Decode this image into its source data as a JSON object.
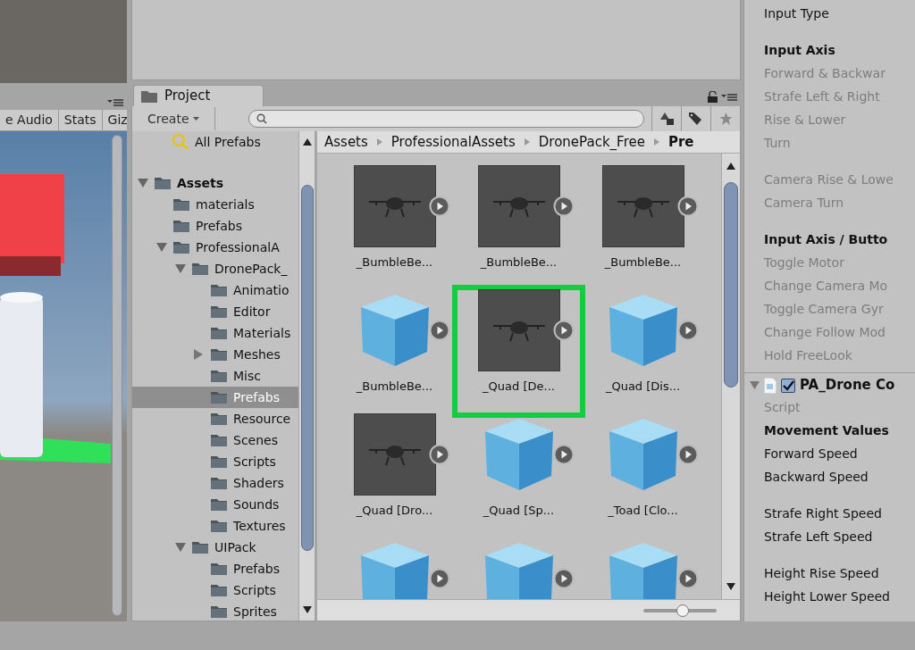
{
  "scene_view": {
    "toolbar": [
      "e Audio",
      "Stats",
      "Giz"
    ]
  },
  "project": {
    "tab": "Project",
    "create_button": "Create",
    "favorites": [
      {
        "label": "All Prefabs",
        "selected": false
      }
    ],
    "tree": [
      {
        "label": "Assets",
        "expanded": true,
        "selected": false,
        "children": [
          {
            "label": "materials",
            "selected": false
          },
          {
            "label": "Prefabs",
            "selected": false
          },
          {
            "label": "ProfessionalA",
            "expanded": true,
            "selected": false,
            "children": [
              {
                "label": "DronePack_",
                "expanded": true,
                "selected": false,
                "children": [
                  {
                    "label": "Animatio",
                    "selected": false
                  },
                  {
                    "label": "Editor",
                    "selected": false
                  },
                  {
                    "label": "Materials",
                    "selected": false
                  },
                  {
                    "label": "Meshes",
                    "expanded": false,
                    "selected": false
                  },
                  {
                    "label": "Misc",
                    "selected": false
                  },
                  {
                    "label": "Prefabs",
                    "selected": true
                  },
                  {
                    "label": "Resource",
                    "selected": false
                  },
                  {
                    "label": "Scenes",
                    "selected": false
                  },
                  {
                    "label": "Scripts",
                    "selected": false
                  },
                  {
                    "label": "Shaders",
                    "selected": false
                  },
                  {
                    "label": "Sounds",
                    "selected": false
                  },
                  {
                    "label": "Textures",
                    "selected": false
                  }
                ]
              },
              {
                "label": "UIPack",
                "expanded": true,
                "selected": false,
                "children": [
                  {
                    "label": "Prefabs",
                    "selected": false
                  },
                  {
                    "label": "Scripts",
                    "selected": false
                  },
                  {
                    "label": "Sprites",
                    "selected": false
                  }
                ]
              }
            ]
          }
        ]
      }
    ],
    "breadcrumb": [
      {
        "label": "Assets",
        "current": false
      },
      {
        "label": "ProfessionalAssets",
        "current": false
      },
      {
        "label": "DronePack_Free",
        "current": false
      },
      {
        "label": "Pre",
        "current": true
      }
    ],
    "assets": [
      {
        "label": "_BumbleBe...",
        "kind": "preview",
        "highlighted": false
      },
      {
        "label": "_BumbleBe...",
        "kind": "preview",
        "highlighted": false
      },
      {
        "label": "_BumbleBe...",
        "kind": "preview",
        "highlighted": false
      },
      {
        "label": "_BumbleBe...",
        "kind": "cube",
        "highlighted": false
      },
      {
        "label": "_Quad [De...",
        "kind": "preview",
        "highlighted": true
      },
      {
        "label": "_Quad [Dis...",
        "kind": "cube",
        "highlighted": false
      },
      {
        "label": "_Quad [Dro...",
        "kind": "preview",
        "highlighted": false
      },
      {
        "label": "_Quad [Sp...",
        "kind": "cube",
        "highlighted": false
      },
      {
        "label": "_Toad [Clo...",
        "kind": "cube",
        "highlighted": false
      },
      {
        "kind": "cube",
        "highlighted": false
      },
      {
        "kind": "cube",
        "highlighted": false
      },
      {
        "kind": "cube",
        "highlighted": false
      }
    ],
    "zoom_slider": {
      "level": 0.55
    }
  },
  "inspector": {
    "groups": [
      [
        {
          "text": "Input Type",
          "kind": "field",
          "disabled": false
        }
      ],
      [
        {
          "text": "Input Axis",
          "kind": "header",
          "disabled": false
        },
        {
          "text": "Forward & Backwar",
          "kind": "field",
          "disabled": true
        },
        {
          "text": "Strafe Left & Right",
          "kind": "field",
          "disabled": true
        },
        {
          "text": "Rise & Lower",
          "kind": "field",
          "disabled": true
        },
        {
          "text": "Turn",
          "kind": "field",
          "disabled": true
        }
      ],
      [
        {
          "text": "Camera Rise & Lowe",
          "kind": "field",
          "disabled": true
        },
        {
          "text": "Camera Turn",
          "kind": "field",
          "disabled": true
        }
      ],
      [
        {
          "text": "Input Axis / Butto",
          "kind": "header",
          "disabled": false
        },
        {
          "text": "Toggle Motor",
          "kind": "field",
          "disabled": true
        },
        {
          "text": "Change Camera Mo",
          "kind": "field",
          "disabled": true
        },
        {
          "text": "Toggle Camera Gyr",
          "kind": "field",
          "disabled": true
        },
        {
          "text": "Change Follow Mod",
          "kind": "field",
          "disabled": true
        },
        {
          "text": "Hold FreeLook",
          "kind": "field",
          "disabled": true
        }
      ]
    ],
    "component": {
      "title": "PA_Drone Co",
      "expanded": true,
      "enabled": true,
      "groups": [
        [
          {
            "text": "Script",
            "kind": "field",
            "disabled": true
          },
          {
            "text": "Movement Values",
            "kind": "header",
            "disabled": false
          },
          {
            "text": "Forward Speed",
            "kind": "field",
            "disabled": false
          },
          {
            "text": "Backward Speed",
            "kind": "field",
            "disabled": false
          }
        ],
        [
          {
            "text": "Strafe Right Speed",
            "kind": "field",
            "disabled": false
          },
          {
            "text": "Strafe Left Speed",
            "kind": "field",
            "disabled": false
          }
        ],
        [
          {
            "text": "Height Rise Speed",
            "kind": "field",
            "disabled": false
          },
          {
            "text": "Height Lower Speed",
            "kind": "field",
            "disabled": false
          }
        ]
      ]
    }
  }
}
